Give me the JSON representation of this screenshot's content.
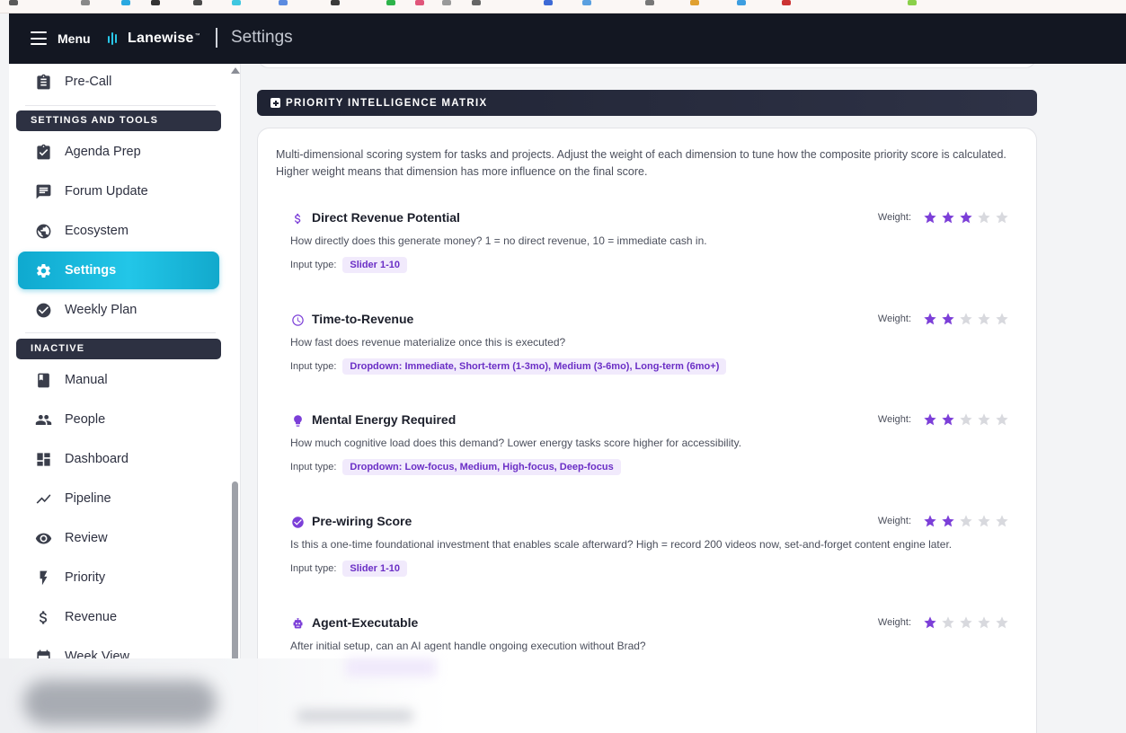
{
  "header": {
    "menu_label": "Menu",
    "brand": "Lanewise",
    "brand_tm": "™",
    "page_title": "Settings"
  },
  "sidebar": {
    "top_item": {
      "label": "Pre-Call",
      "icon": "clipboard-icon"
    },
    "sections": [
      {
        "title": "SETTINGS AND TOOLS",
        "items": [
          {
            "label": "Agenda Prep",
            "icon": "clipboard-check-icon",
            "active": false
          },
          {
            "label": "Forum Update",
            "icon": "chat-icon",
            "active": false
          },
          {
            "label": "Ecosystem",
            "icon": "globe-icon",
            "active": false
          },
          {
            "label": "Settings",
            "icon": "gear-icon",
            "active": true
          },
          {
            "label": "Weekly Plan",
            "icon": "check-circle-icon",
            "active": false
          }
        ]
      },
      {
        "title": "INACTIVE",
        "items": [
          {
            "label": "Manual",
            "icon": "book-icon"
          },
          {
            "label": "People",
            "icon": "people-icon"
          },
          {
            "label": "Dashboard",
            "icon": "dashboard-icon"
          },
          {
            "label": "Pipeline",
            "icon": "trend-icon"
          },
          {
            "label": "Review",
            "icon": "eye-icon"
          },
          {
            "label": "Priority",
            "icon": "bolt-icon"
          },
          {
            "label": "Revenue",
            "icon": "dollar-icon"
          },
          {
            "label": "Week View",
            "icon": "calendar-icon"
          }
        ]
      }
    ]
  },
  "matrix": {
    "section_title": "PRIORITY INTELLIGENCE MATRIX",
    "intro": "Multi-dimensional scoring system for tasks and projects. Adjust the weight of each dimension to tune how the composite priority score is calculated. Higher weight means that dimension has more influence on the final score.",
    "weight_label": "Weight:",
    "input_type_label": "Input type:",
    "max_stars": 5,
    "accent_color": "#7c3fd8",
    "dimensions": [
      {
        "name": "Direct Revenue Potential",
        "icon": "dollar-icon",
        "description": "How directly does this generate money? 1 = no direct revenue, 10 = immediate cash in.",
        "input_type": "Slider 1-10",
        "weight": 3
      },
      {
        "name": "Time-to-Revenue",
        "icon": "clock-icon",
        "description": "How fast does revenue materialize once this is executed?",
        "input_type": "Dropdown: Immediate, Short-term (1-3mo), Medium (3-6mo), Long-term (6mo+)",
        "weight": 2
      },
      {
        "name": "Mental Energy Required",
        "icon": "lightbulb-icon",
        "description": "How much cognitive load does this demand? Lower energy tasks score higher for accessibility.",
        "input_type": "Dropdown: Low-focus, Medium, High-focus, Deep-focus",
        "weight": 2
      },
      {
        "name": "Pre-wiring Score",
        "icon": "check-circle-icon",
        "description": "Is this a one-time foundational investment that enables scale afterward? High = record 200 videos now, set-and-forget content engine later.",
        "input_type": "Slider 1-10",
        "weight": 2
      },
      {
        "name": "Agent-Executable",
        "icon": "robot-icon",
        "description": "After initial setup, can an AI agent handle ongoing execution without Brad?",
        "input_type": "",
        "weight": 1
      }
    ]
  }
}
